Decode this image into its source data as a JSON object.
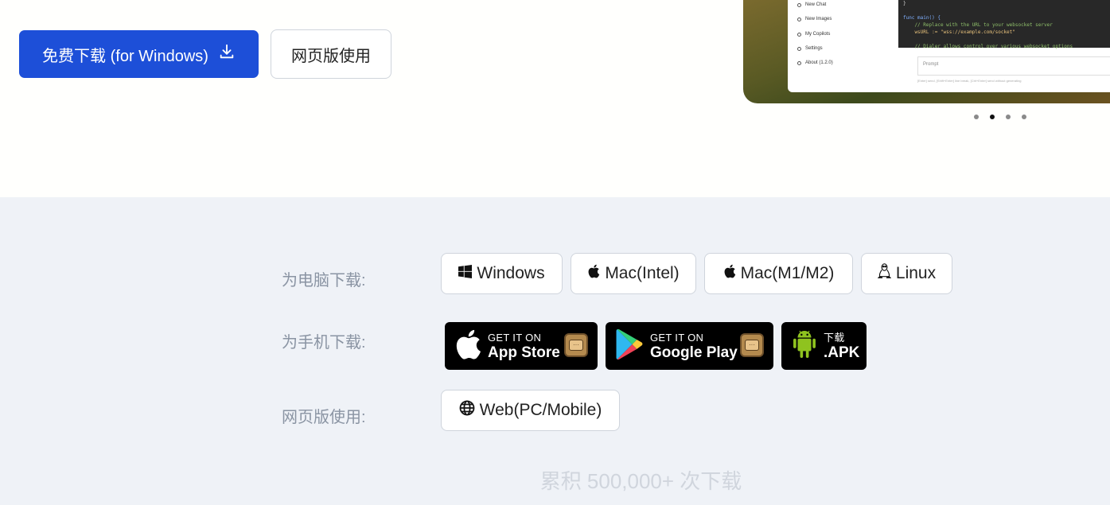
{
  "hero": {
    "primary_button": {
      "label": "免费下载 (for Windows)",
      "icon": "download-icon"
    },
    "secondary_button": {
      "label": "网页版使用"
    },
    "preview": {
      "sidebar_items": [
        "New Chat",
        "New Images",
        "My Copilots",
        "Settings",
        "About (1.2.0)"
      ],
      "code_lines": [
        "}",
        "",
        "func main() {",
        "    // Replace with the URL to your websocket server",
        "    wsURL := \"wss://example.com/socket\"",
        "",
        "    // Dialer allows control over various websocket options"
      ],
      "prompt_placeholder": "Prompt",
      "hint": "[Enter] send, [Shift+Enter] line break, [Ctrl+Enter] send without generating"
    },
    "carousel": {
      "count": 4,
      "active_index": 1
    }
  },
  "download": {
    "pc_label": "为电脑下载:",
    "pc_buttons": [
      {
        "label": "Windows",
        "icon": "windows-icon"
      },
      {
        "label": "Mac(Intel)",
        "icon": "apple-icon"
      },
      {
        "label": "Mac(M1/M2)",
        "icon": "apple-icon"
      },
      {
        "label": "Linux",
        "icon": "linux-icon"
      }
    ],
    "mobile_label": "为手机下载:",
    "mobile_buttons": [
      {
        "small": "GET IT ON",
        "big": "App Store",
        "icon": "apple-icon"
      },
      {
        "small": "GET IT ON",
        "big": "Google Play",
        "icon": "google-play-icon"
      },
      {
        "small": "下载",
        "big": ".APK",
        "icon": "android-icon"
      }
    ],
    "web_label": "网页版使用:",
    "web_button": {
      "label": "Web(PC/Mobile)",
      "icon": "globe-icon"
    },
    "count_text": "累积 500,000+ 次下载"
  },
  "colors": {
    "primary": "#1d4fd8",
    "section_bg": "#eff2f7",
    "label": "#8a94a3",
    "count": "#d0d5dd"
  }
}
